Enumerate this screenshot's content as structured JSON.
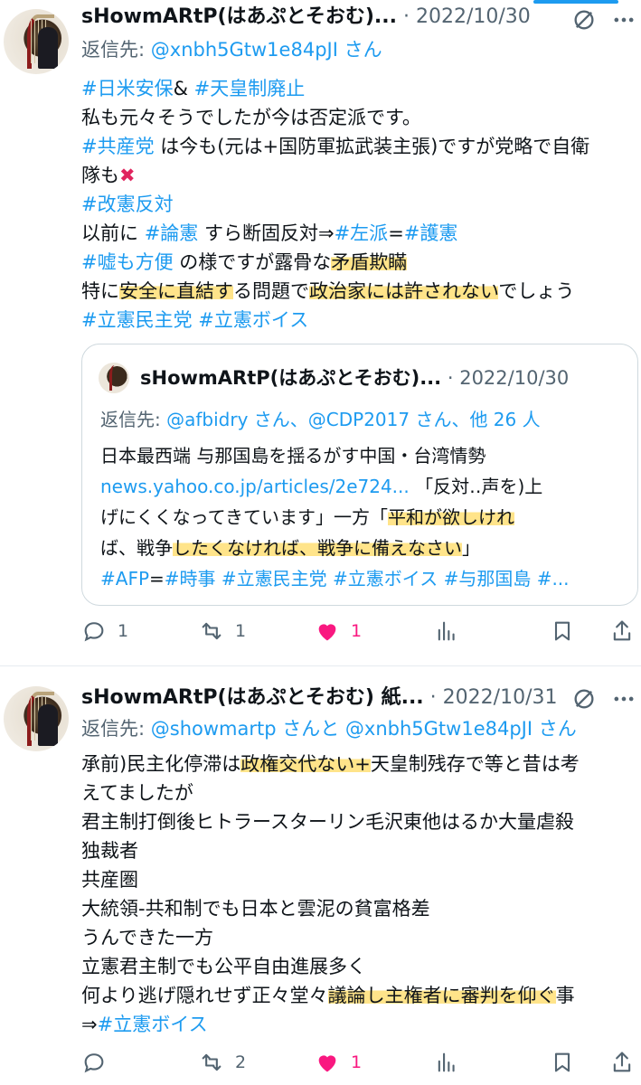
{
  "tweets": [
    {
      "name": "sHowmARtP(はあぷとそおむ)...",
      "date": "2022/10/30",
      "sep": "·",
      "reply_prefix": "返信先: ",
      "reply_handles": "@xnbh5Gtw1e84pJI さん",
      "lines": [
        [
          {
            "t": "#日米安保",
            "c": "link"
          },
          {
            "t": "& "
          },
          {
            "t": "#天皇制廃止",
            "c": "link"
          }
        ],
        [
          {
            "t": "私も元々そうでしたが今は否定派です。"
          }
        ],
        [
          {
            "t": "#共産党",
            "c": "link"
          },
          {
            "t": " は今も(元は+国防軍拡武装主張)ですが党略で自衛"
          }
        ],
        [
          {
            "t": "隊も"
          },
          {
            "t": "✖",
            "c": "cross"
          }
        ],
        [
          {
            "t": "#改憲反対",
            "c": "link"
          }
        ],
        [
          {
            "t": "以前に "
          },
          {
            "t": "#論憲",
            "c": "link"
          },
          {
            "t": " すら断固反対⇒"
          },
          {
            "t": "#左派",
            "c": "link"
          },
          {
            "t": "="
          },
          {
            "t": "#護憲",
            "c": "link"
          }
        ],
        [
          {
            "t": "#嘘も方便",
            "c": "link"
          },
          {
            "t": " の様ですが露骨な"
          },
          {
            "t": "矛盾欺瞞",
            "c": "hl"
          }
        ],
        [
          {
            "t": "特に"
          },
          {
            "t": "安全に直結す",
            "c": "hl"
          },
          {
            "t": "る問題で"
          },
          {
            "t": "政治家には許されない",
            "c": "hl"
          },
          {
            "t": "でしょう"
          }
        ],
        [
          {
            "t": "#立憲民主党",
            "c": "link"
          },
          {
            "t": " "
          },
          {
            "t": "#立憲ボイス",
            "c": "link"
          }
        ]
      ],
      "quote": {
        "name": "sHowmARtP(はあぷとそおむ)...",
        "sep": "·",
        "date": "2022/10/30",
        "reply_prefix": "返信先: ",
        "reply_handles": "@afbidry さん、@CDP2017 さん、他 26 人",
        "lines": [
          [
            {
              "t": "日本最西端 与那国島を揺るがす中国・台湾情勢"
            }
          ],
          [
            {
              "t": "news.yahoo.co.jp/articles/2e724...",
              "c": "link"
            },
            {
              "t": " 「反対‥声を)上"
            }
          ],
          [
            {
              "t": "げにくくなってきています」一方「"
            },
            {
              "t": "平和が欲しけれ",
              "c": "hl"
            }
          ],
          [
            {
              "t": "ば、戦争"
            },
            {
              "t": "したくなければ、戦争に備えなさい",
              "c": "hl"
            },
            {
              "t": "」"
            }
          ],
          [
            {
              "t": "#AFP",
              "c": "link"
            },
            {
              "t": "="
            },
            {
              "t": "#時事",
              "c": "link"
            },
            {
              "t": " "
            },
            {
              "t": "#立憲民主党",
              "c": "link"
            },
            {
              "t": " "
            },
            {
              "t": "#立憲ボイス",
              "c": "link"
            },
            {
              "t": " "
            },
            {
              "t": "#与那国島",
              "c": "link"
            },
            {
              "t": " "
            },
            {
              "t": "#...",
              "c": "link"
            }
          ]
        ]
      },
      "actions": {
        "reply": "1",
        "retweet": "1",
        "like": "1"
      }
    },
    {
      "name": "sHowmARtP(はあぷとそおむ) 紙...",
      "date": "2022/10/31",
      "sep": "·",
      "reply_prefix": "返信先: ",
      "reply_handles": "@showmartp さんと @xnbh5Gtw1e84pJI さん",
      "lines": [
        [
          {
            "t": "承前)民主化停滞は"
          },
          {
            "t": "政権交代ない+",
            "c": "hl"
          },
          {
            "t": "天皇制残存で等と昔は考"
          }
        ],
        [
          {
            "t": "えてましたが"
          }
        ],
        [
          {
            "t": "君主制打倒後ヒトラースターリン毛沢東他はるか大量虐殺"
          }
        ],
        [
          {
            "t": "独裁者"
          }
        ],
        [
          {
            "t": "共産圏"
          }
        ],
        [
          {
            "t": "大統領-共和制でも日本と雲泥の貧富格差"
          }
        ],
        [
          {
            "t": "うんできた一方"
          }
        ],
        [
          {
            "t": "立憲君主制でも公平自由進展多く"
          }
        ],
        [
          {
            "t": "何より逃げ隠れせず正々堂々"
          },
          {
            "t": "議論し主権者に審判を仰ぐ",
            "c": "hl"
          },
          {
            "t": "事"
          }
        ],
        [
          {
            "t": "⇒"
          },
          {
            "t": "#立憲ボイス",
            "c": "link"
          }
        ]
      ],
      "actions": {
        "reply": "",
        "retweet": "2",
        "like": "1"
      }
    }
  ],
  "colors": {
    "accent": "#1d9bf0",
    "like": "#f91880",
    "highlight": "#ffe48a",
    "muted": "#536471"
  },
  "icons": [
    "reply-icon",
    "retweet-icon",
    "like-icon",
    "views-icon",
    "bookmark-icon",
    "share-icon",
    "more-icon"
  ]
}
